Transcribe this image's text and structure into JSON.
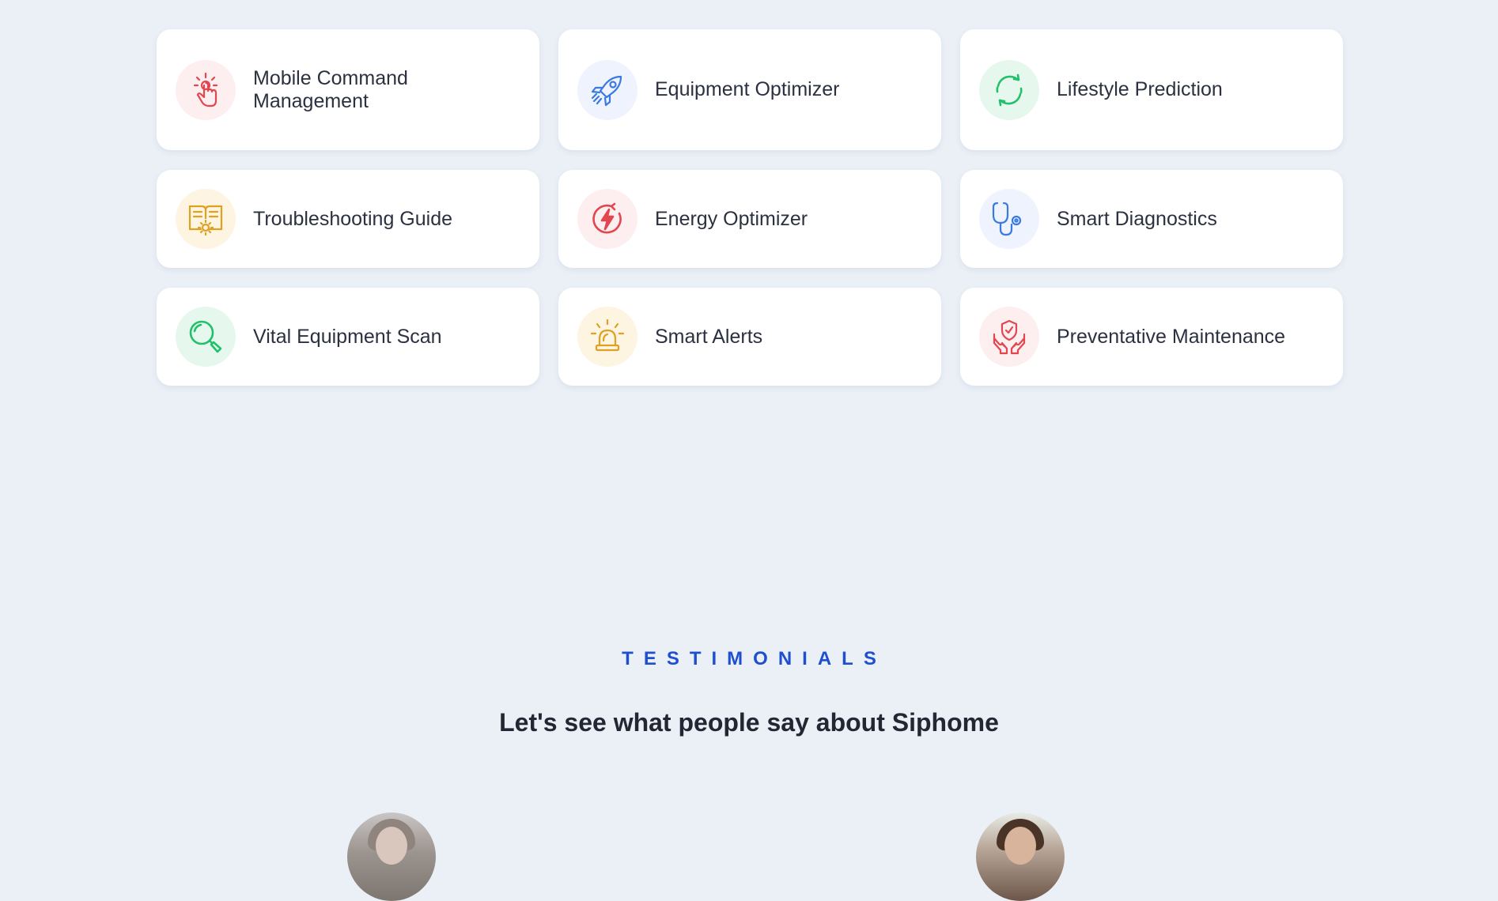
{
  "features": [
    {
      "label": "Mobile Command Management",
      "icon": "tap-hand-icon",
      "name": "card-mobile-command-management",
      "bg": "#fdeef0",
      "color": "#e2474f"
    },
    {
      "label": "Equipment Optimizer",
      "icon": "rocket-icon",
      "name": "card-equipment-optimizer",
      "bg": "#eef3fd",
      "color": "#3a7ae0"
    },
    {
      "label": "Lifestyle Prediction",
      "icon": "refresh-cycle-icon",
      "name": "card-lifestyle-prediction",
      "bg": "#e6f8ee",
      "color": "#22c06a"
    },
    {
      "label": "Troubleshooting Guide",
      "icon": "book-gear-icon",
      "name": "card-troubleshooting-guide",
      "bg": "#fdf4e2",
      "color": "#e0a020"
    },
    {
      "label": "Energy Optimizer",
      "icon": "energy-bolt-icon",
      "name": "card-energy-optimizer",
      "bg": "#fdeef0",
      "color": "#e2474f"
    },
    {
      "label": "Smart Diagnostics",
      "icon": "stethoscope-icon",
      "name": "card-smart-diagnostics",
      "bg": "#eef3fd",
      "color": "#3a7ae0"
    },
    {
      "label": "Vital Equipment Scan",
      "icon": "magnifier-icon",
      "name": "card-vital-equipment-scan",
      "bg": "#e6f8ee",
      "color": "#22c06a"
    },
    {
      "label": "Smart Alerts",
      "icon": "alarm-siren-icon",
      "name": "card-smart-alerts",
      "bg": "#fdf4e2",
      "color": "#e0a020"
    },
    {
      "label": "Preventative Maintenance",
      "icon": "hands-shield-icon",
      "name": "card-preventative-maintenance",
      "bg": "#fdeef0",
      "color": "#e2474f"
    }
  ],
  "testimonials": {
    "eyebrow": "TESTIMONIALS",
    "heading": "Let's see what people say about Siphome",
    "accent": "#1e4fd0"
  }
}
